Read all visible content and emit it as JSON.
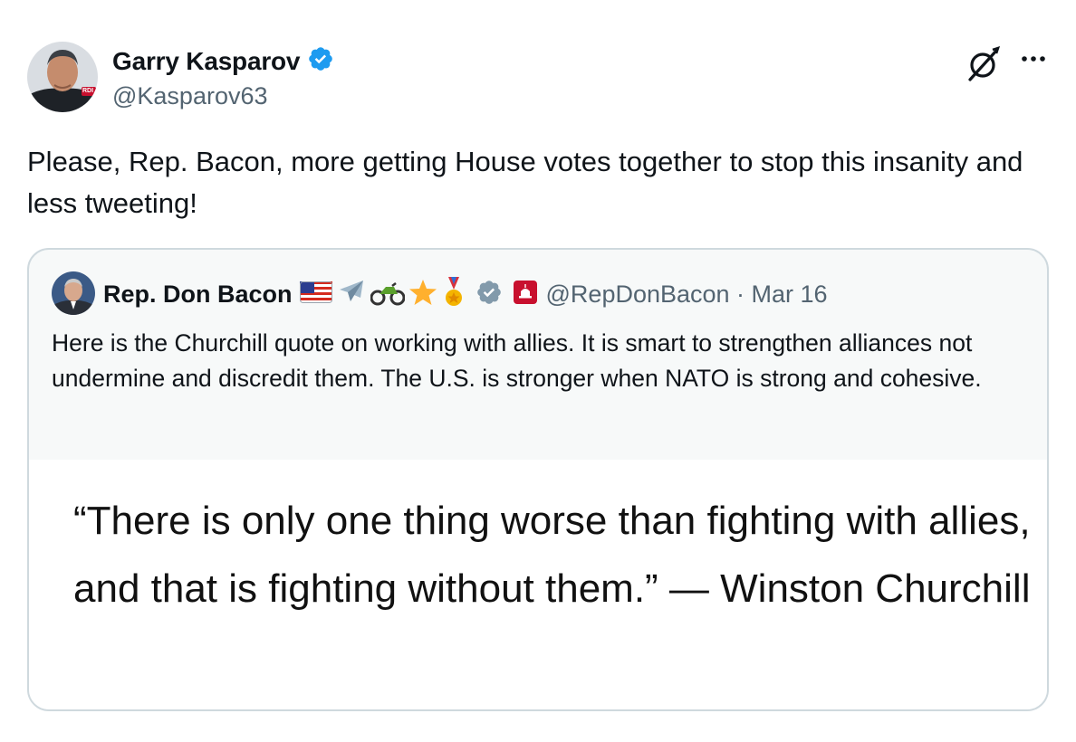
{
  "author": {
    "name": "Garry Kasparov",
    "handle": "@Kasparov63",
    "avatar_badge": "RDI"
  },
  "tweet": {
    "text": "Please, Rep. Bacon, more getting House votes together to stop this insanity and less tweeting!"
  },
  "quoted": {
    "name": "Rep. Don Bacon",
    "emojis": [
      "us-flag-icon",
      "airplane-icon",
      "motorcycle-icon",
      "star-icon",
      "medal-icon"
    ],
    "handle_date": "@RepDonBacon · Mar 16",
    "text": "Here is the Churchill quote on working with allies. It is smart to strengthen alliances not undermine and discredit them. The U.S. is stronger when NATO is strong and cohesive.",
    "image_text": "“There is only one thing worse than fighting with allies, and that is fighting without them.” — Winston Churchill"
  },
  "icons": [
    "verified-badge-icon",
    "grok-icon",
    "more-options-icon",
    "gray-verified-badge-icon",
    "congress-badge-icon"
  ],
  "colors": {
    "verified_blue": "#1d9bf0",
    "gray_badge": "#829aab",
    "secondary_text": "#536471",
    "card_border": "#cfd9de",
    "congress_red": "#c8102e"
  }
}
